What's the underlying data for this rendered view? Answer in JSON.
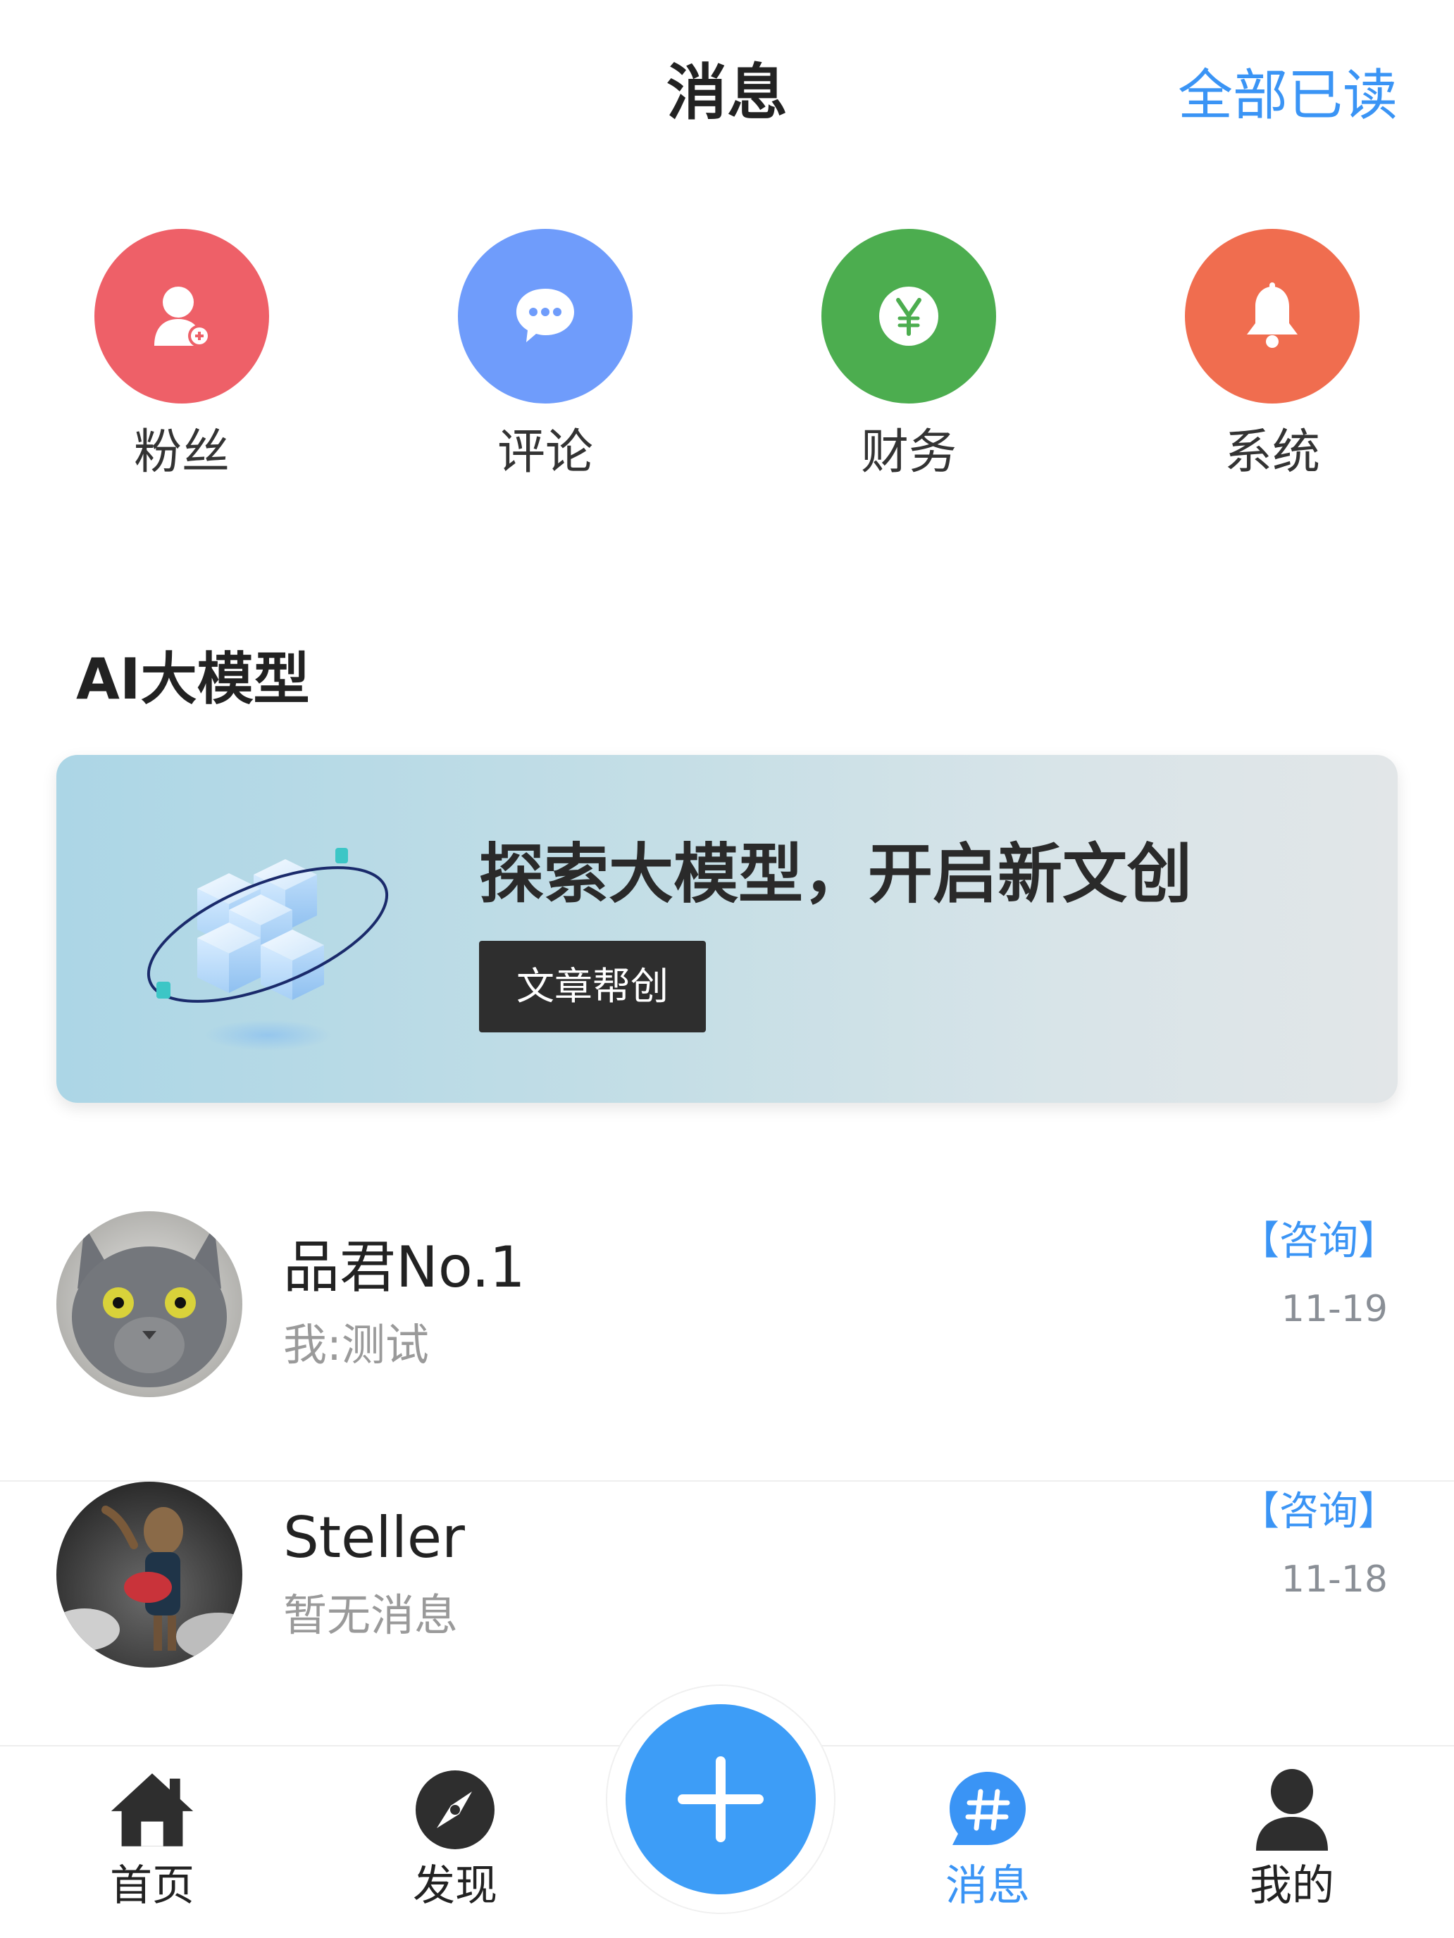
{
  "header": {
    "title": "消息",
    "mark_all_read": "全部已读"
  },
  "categories": [
    {
      "label": "粉丝",
      "icon": "add-user-icon",
      "color": "#ee6068"
    },
    {
      "label": "评论",
      "icon": "chat-bubble-icon",
      "color": "#6f9cfb"
    },
    {
      "label": "财务",
      "icon": "yen-icon",
      "color": "#4cad4f"
    },
    {
      "label": "系统",
      "icon": "bell-icon",
      "color": "#f06d4f"
    }
  ],
  "ai_section": {
    "title": "AI大模型",
    "banner_headline": "探索大模型，开启新文创",
    "banner_button": "文章帮创",
    "illustration": "cube-orbit-icon"
  },
  "messages": [
    {
      "name": "品君No.1",
      "preview": "我:测试",
      "tag": "【咨询】",
      "date": "11-19",
      "avatar": "cat-avatar"
    },
    {
      "name": "Steller",
      "preview": "暂无消息",
      "tag": "【咨询】",
      "date": "11-18",
      "avatar": "groot-avatar"
    }
  ],
  "tabbar": {
    "tabs": [
      {
        "label": "首页",
        "icon": "home-icon"
      },
      {
        "label": "发现",
        "icon": "compass-icon"
      },
      {
        "label": "消息",
        "icon": "hashtag-chat-icon",
        "active": true
      },
      {
        "label": "我的",
        "icon": "person-icon"
      }
    ],
    "fab_icon": "plus-icon"
  },
  "colors": {
    "accent": "#3a94f5",
    "fab": "#3d9df7"
  }
}
